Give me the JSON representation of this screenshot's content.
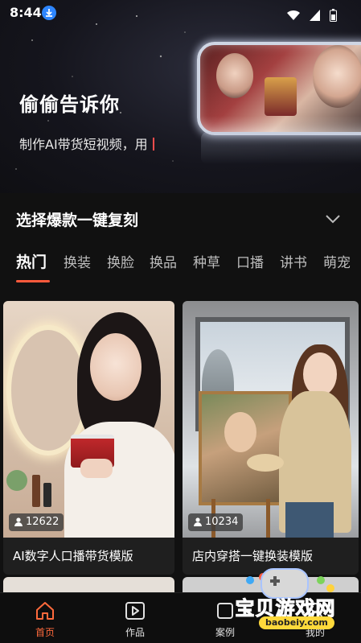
{
  "status_bar": {
    "time": "8:44"
  },
  "hero": {
    "title": "偷偷告诉你",
    "subtitle": "制作AI带货短视频，用"
  },
  "section": {
    "title": "选择爆款一键复刻"
  },
  "tabs": [
    "热门",
    "换装",
    "换脸",
    "换品",
    "种草",
    "口播",
    "讲书",
    "萌宠"
  ],
  "active_tab": "热门",
  "cards": [
    {
      "count": "12622",
      "title": "AI数字人口播带货模版"
    },
    {
      "count": "10234",
      "title": "店内穿搭一键换装模版"
    }
  ],
  "nav": [
    {
      "label": "首页",
      "icon": "home-icon",
      "active": true
    },
    {
      "label": "作品",
      "icon": "play-icon",
      "active": false
    },
    {
      "label": "案例",
      "icon": "case-icon",
      "active": false
    },
    {
      "label": "我的",
      "icon": "profile-icon",
      "active": false
    }
  ],
  "watermark": {
    "brand": "宝贝游戏网",
    "url": "baobeiy.com"
  },
  "colors": {
    "accent": "#ff5a3c",
    "background": "#111111",
    "download_badge": "#2e86ff"
  }
}
